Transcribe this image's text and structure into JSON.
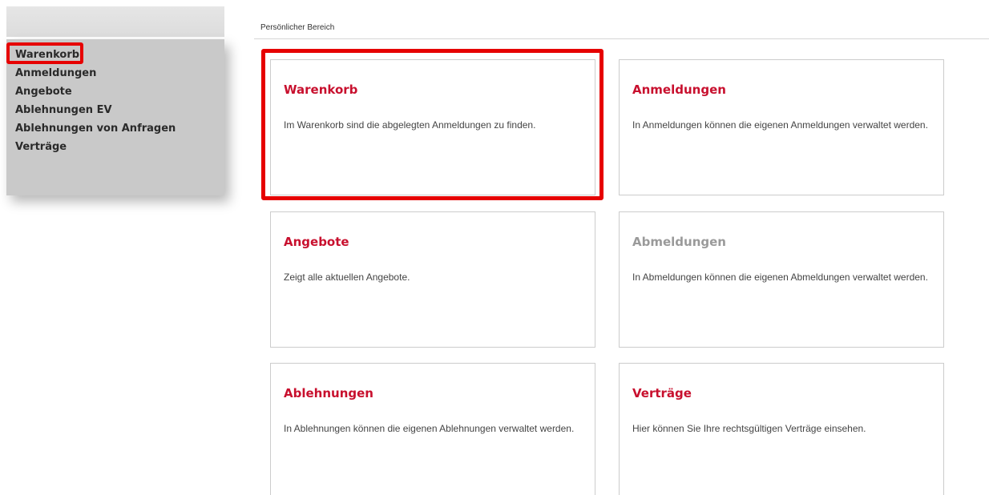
{
  "sidebar": {
    "items": [
      {
        "label": "Warenkorb"
      },
      {
        "label": "Anmeldungen"
      },
      {
        "label": "Angebote"
      },
      {
        "label": "Ablehnungen EV"
      },
      {
        "label": "Ablehnungen von Anfragen"
      },
      {
        "label": "Verträge"
      }
    ],
    "active_index": 0
  },
  "breadcrumb": "Persönlicher Bereich",
  "tiles": [
    {
      "title": "Warenkorb",
      "text": "Im Warenkorb sind die abgelegten Anmeldungen zu finden.",
      "enabled": true
    },
    {
      "title": "Anmeldungen",
      "text": "In Anmeldungen können die eigenen Anmeldungen verwaltet werden.",
      "enabled": true
    },
    {
      "title": "Angebote",
      "text": "Zeigt alle aktuellen Angebote.",
      "enabled": true
    },
    {
      "title": "Abmeldungen",
      "text": "In Abmeldungen können die eigenen Abmeldungen verwaltet werden.",
      "enabled": false
    },
    {
      "title": "Ablehnungen",
      "text": "In Ablehnungen können die eigenen Ablehnungen verwaltet werden.",
      "enabled": true
    },
    {
      "title": "Verträge",
      "text": "Hier können Sie Ihre rechtsgültigen Verträge einsehen.",
      "enabled": true
    }
  ],
  "colors": {
    "accent": "#c8102e",
    "highlight": "#e60000",
    "disabled": "#9a9a9a",
    "sidebar_bg": "#c9c9c9"
  }
}
